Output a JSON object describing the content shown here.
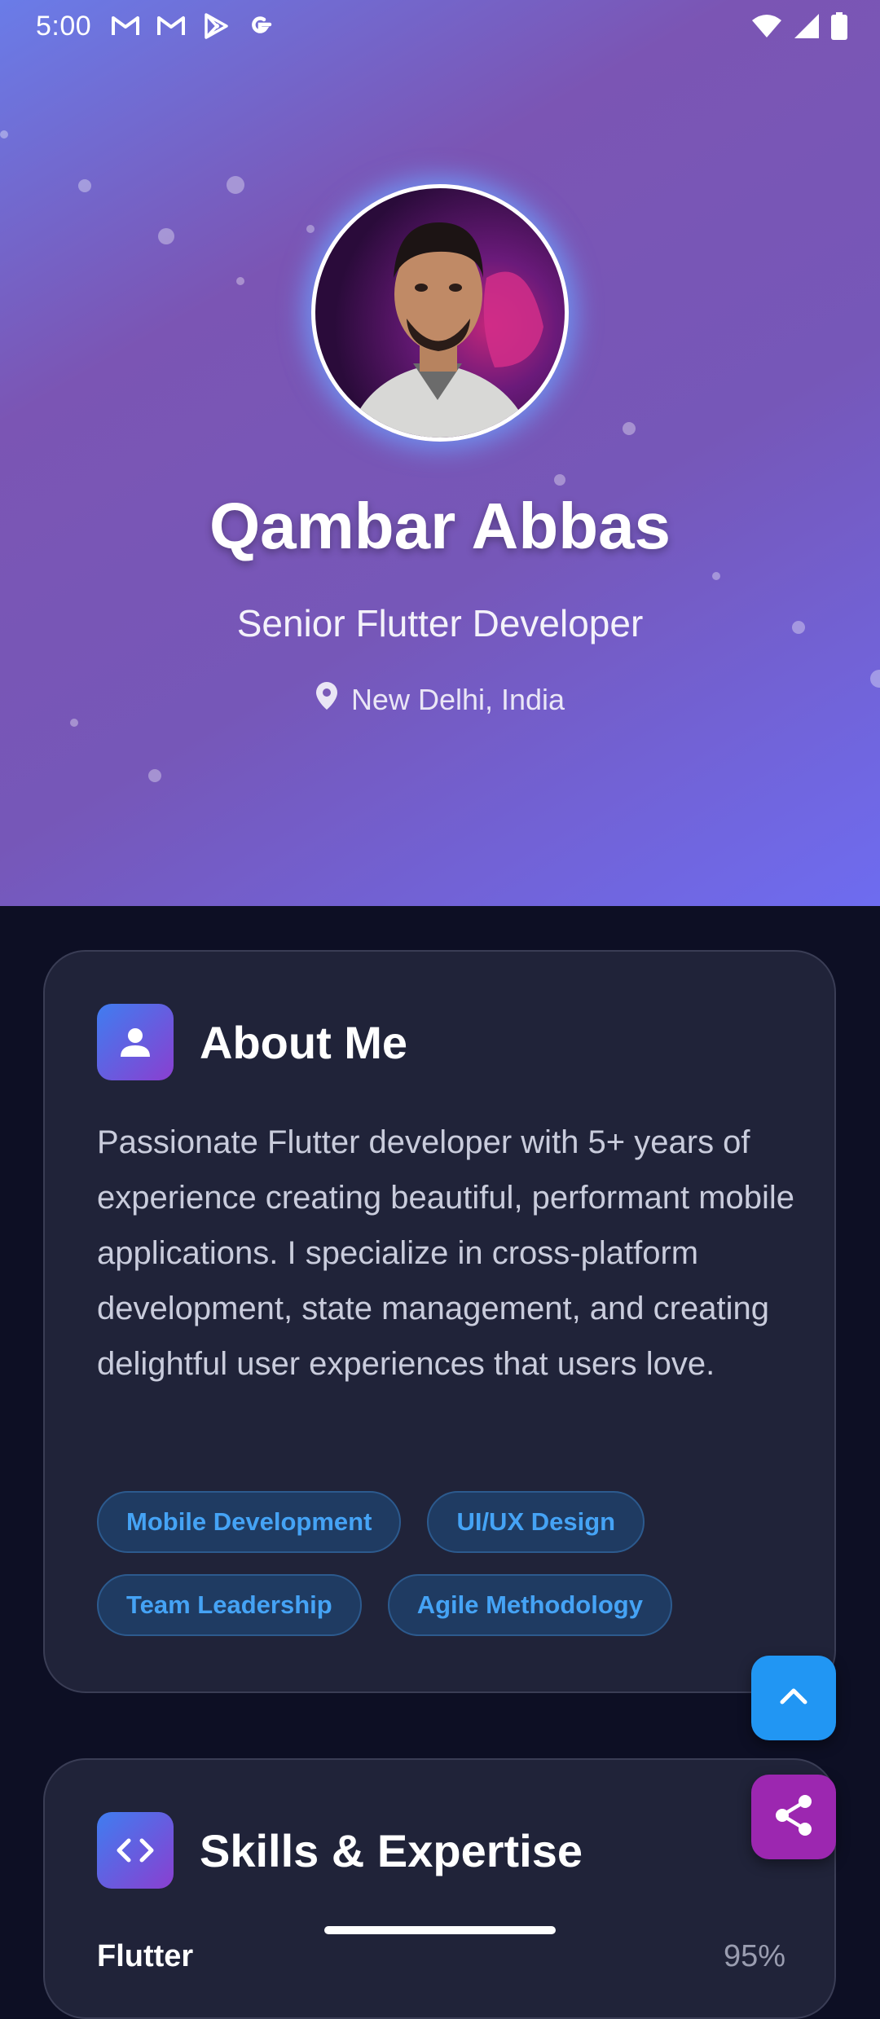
{
  "status_bar": {
    "time": "5:00",
    "left_icons": [
      "gmail-icon",
      "gmail-icon",
      "play-store-icon",
      "google-icon"
    ],
    "right_icons": [
      "wifi-icon",
      "signal-icon",
      "battery-icon"
    ]
  },
  "profile": {
    "name": "Qambar Abbas",
    "role": "Senior Flutter Developer",
    "location": "New Delhi, India",
    "location_icon": "location-pin-icon"
  },
  "about": {
    "title": "About Me",
    "icon": "person-icon",
    "text": "Passionate Flutter developer with 5+ years of experience creating beautiful, performant mobile applications. I specialize in cross-platform development, state management, and creating delightful user experiences that users love.",
    "tags": [
      "Mobile Development",
      "UI/UX Design",
      "Team Leadership",
      "Agile Methodology"
    ]
  },
  "skills": {
    "title": "Skills & Expertise",
    "icon": "code-icon",
    "items": [
      {
        "name": "Flutter",
        "percent": "95%"
      }
    ]
  },
  "fabs": {
    "scroll_top_icon": "chevron-up-icon",
    "share_icon": "share-icon"
  },
  "colors": {
    "background": "#0d0f24",
    "card": "#202339",
    "tag_text": "#45a3f5",
    "fab_up": "#2196f3",
    "fab_share": "#9c27b0"
  }
}
